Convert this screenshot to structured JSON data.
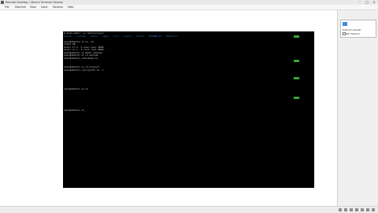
{
  "window": {
    "title": "Remote Desktop / Ubuntu Terminal Session"
  },
  "menu": [
    "File",
    "Machine",
    "View",
    "Input",
    "Devices",
    "Help"
  ],
  "terminal": {
    "lines": [
      "$ sudo mkdir -p /opt/project",
      "build/   config/   data/   logs/   src/   tests/   tools/   README.md   Makefile",
      "",
      "user@ubuntu:~$ ls -la",
      "total 48",
      "drwxr-xr-x  5 user user 4096 .",
      "drwxr-xr-x  3 root root 4096 ..",
      "user@ubuntu:~$ mkdir backup",
      "user@ubuntu:~$ cd backup",
      "user@ubuntu:~/backup$ ls",
      "",
      "",
      "user@ubuntu:~$ cd project",
      "user@ubuntu:~/project$ ls -l",
      "",
      "",
      "user@ubuntu:~$ ls",
      "",
      "user@ubuntu:~$ _"
    ]
  },
  "panel": {
    "title": "Network Adapter",
    "subtitle": "NAT Network"
  }
}
